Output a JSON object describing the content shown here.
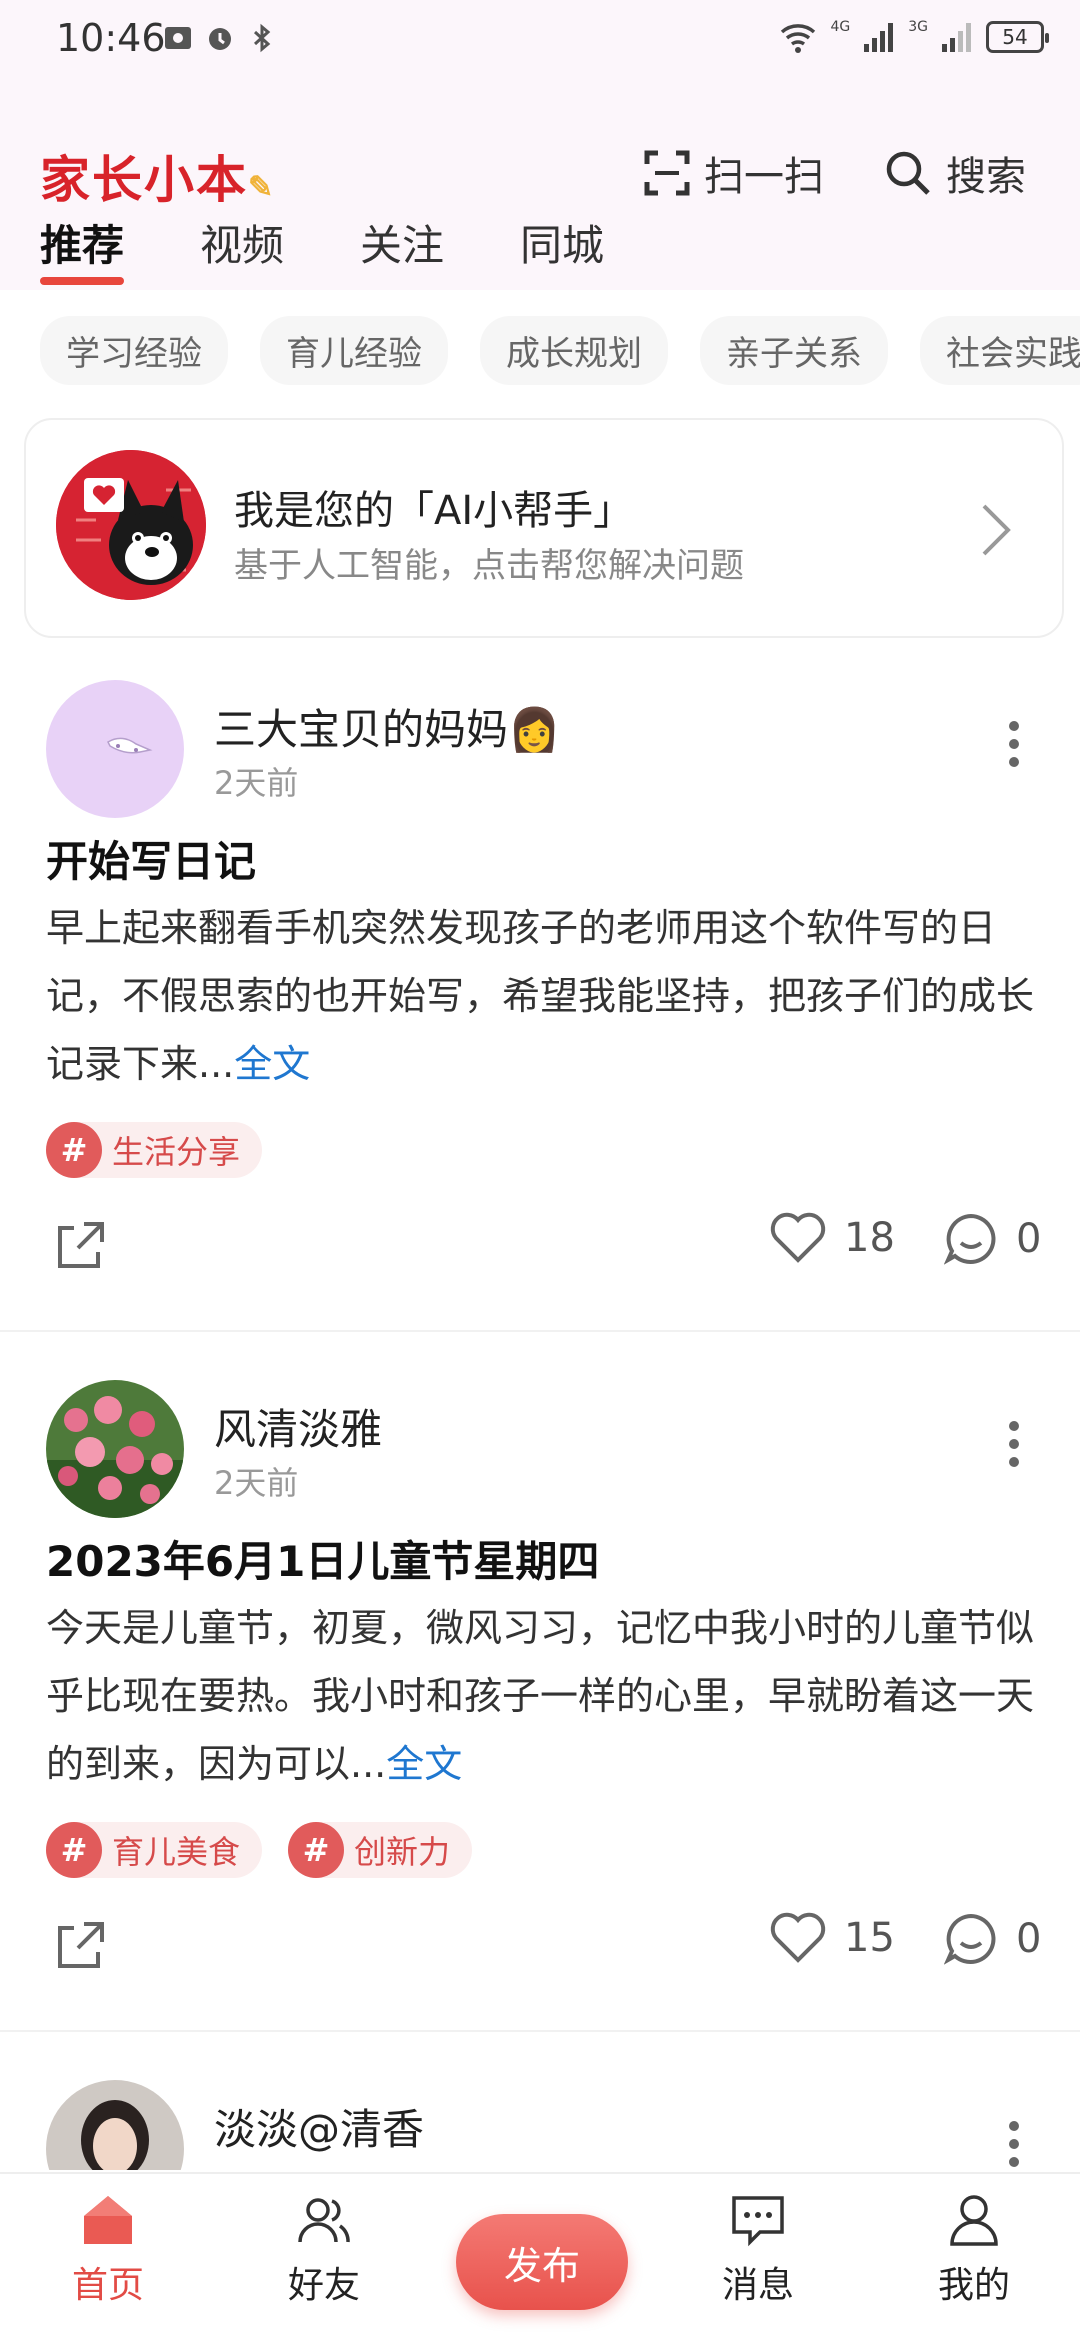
{
  "status_bar": {
    "time": "10:46",
    "net1": "4G",
    "net2": "3G",
    "battery": "54"
  },
  "header": {
    "logo": "家长小本",
    "scan_label": "扫一扫",
    "search_label": "搜索"
  },
  "tabs": [
    {
      "label": "推荐",
      "active": true
    },
    {
      "label": "视频",
      "active": false
    },
    {
      "label": "关注",
      "active": false
    },
    {
      "label": "同城",
      "active": false
    }
  ],
  "chips": [
    "学习经验",
    "育儿经验",
    "成长规划",
    "亲子关系",
    "社会实践"
  ],
  "ai_card": {
    "title": "我是您的「AI小帮手」",
    "subtitle": "基于人工智能，点击帮您解决问题"
  },
  "posts": [
    {
      "author": "三大宝贝的妈妈👩",
      "time": "2天前",
      "title": "开始写日记",
      "body": "早上起来翻看手机突然发现孩子的老师用这个软件写的日记，不假思索的也开始写，希望我能坚持，把孩子们的成长记录下来...",
      "more_link": "全文",
      "tags": [
        "生活分享"
      ],
      "likes": "18",
      "comments": "0"
    },
    {
      "author": "风清淡雅",
      "time": "2天前",
      "title": "2023年6月1日儿童节星期四",
      "body": "今天是儿童节，初夏，微风习习，记忆中我小时的儿童节似乎比现在要热。我小时和孩子一样的心里，早就盼着这一天的到来，因为可以...",
      "more_link": "全文",
      "tags": [
        "育儿美食",
        "创新力"
      ],
      "likes": "15",
      "comments": "0"
    },
    {
      "author": "淡淡@清香"
    }
  ],
  "bottom_nav": {
    "home": "首页",
    "friends": "好友",
    "publish": "发布",
    "messages": "消息",
    "mine": "我的"
  },
  "colors": {
    "accent": "#e24b45",
    "link": "#1f77d0",
    "top_bg": "#fcf6fb"
  }
}
